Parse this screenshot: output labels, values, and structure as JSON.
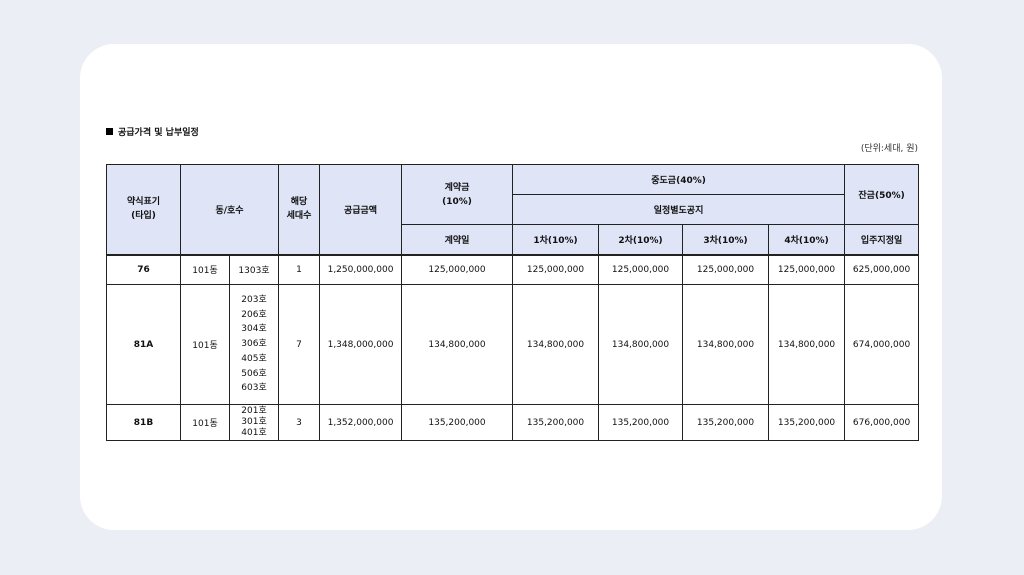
{
  "section_title": "공급가격 및 납부일정",
  "unit_note": "(단위:세대, 원)",
  "headers": {
    "type": [
      "약식표기",
      "(타입)"
    ],
    "dong_ho": "동/호수",
    "units": [
      "해당",
      "세대수"
    ],
    "supply_amount": "공급금액",
    "deposit": [
      "계약금",
      "(10%)"
    ],
    "deposit_date": "계약일",
    "middle": "중도금(40%)",
    "middle_schedule": "일정별도공지",
    "m1": "1차(10%)",
    "m2": "2차(10%)",
    "m3": "3차(10%)",
    "m4": "4차(10%)",
    "balance": "잔금(50%)",
    "balance_date": "입주지정일"
  },
  "rows": [
    {
      "type": "76",
      "dong": "101동",
      "ho": [
        "1303호"
      ],
      "units": "1",
      "supply": "1,250,000,000",
      "deposit": "125,000,000",
      "m1": "125,000,000",
      "m2": "125,000,000",
      "m3": "125,000,000",
      "m4": "125,000,000",
      "balance": "625,000,000"
    },
    {
      "type": "81A",
      "dong": "101동",
      "ho": [
        "203호",
        "206호",
        "304호",
        "306호",
        "405호",
        "506호",
        "603호"
      ],
      "units": "7",
      "supply": "1,348,000,000",
      "deposit": "134,800,000",
      "m1": "134,800,000",
      "m2": "134,800,000",
      "m3": "134,800,000",
      "m4": "134,800,000",
      "balance": "674,000,000"
    },
    {
      "type": "81B",
      "dong": "101동",
      "ho": [
        "201호",
        "301호",
        "401호"
      ],
      "units": "3",
      "supply": "1,352,000,000",
      "deposit": "135,200,000",
      "m1": "135,200,000",
      "m2": "135,200,000",
      "m3": "135,200,000",
      "m4": "135,200,000",
      "balance": "676,000,000"
    }
  ]
}
